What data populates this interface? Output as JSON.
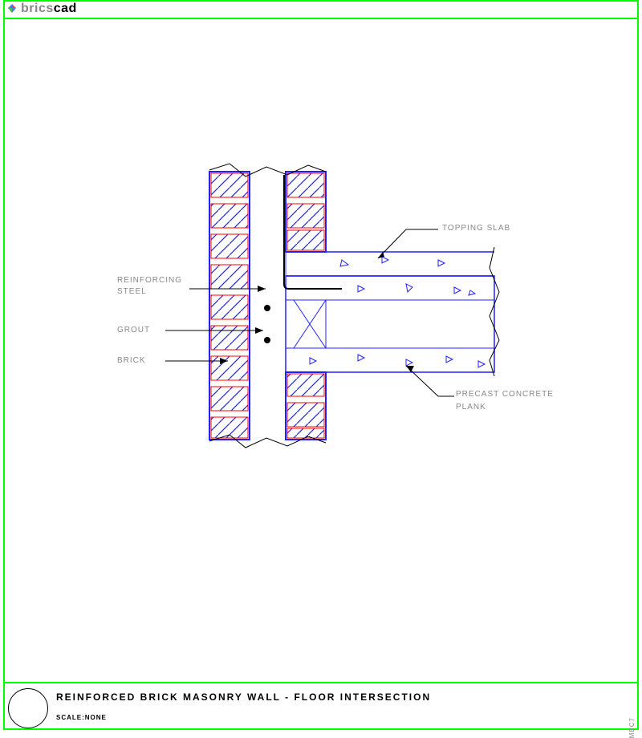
{
  "brand": {
    "part1": "brics",
    "part2": "cad"
  },
  "labels": {
    "topping_slab": "TOPPING SLAB",
    "reinforcing_steel_1": "REINFORCING",
    "reinforcing_steel_2": "STEEL",
    "grout": "GROUT",
    "brick": "BRICK",
    "precast_1": "PRECAST CONCRETE",
    "precast_2": "PLANK"
  },
  "footer": {
    "title": "REINFORCED BRICK MASONRY WALL - FLOOR INTERSECTION",
    "scale": "SCALE:NONE",
    "code": "MBC7"
  }
}
